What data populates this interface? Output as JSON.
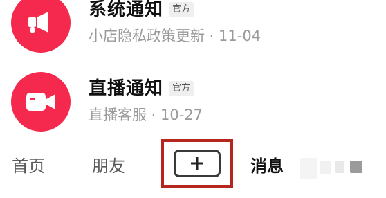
{
  "messages": [
    {
      "title": "系统通知",
      "badge": "官方",
      "subtitle": "小店隐私政策更新 · 11-04",
      "icon": "megaphone-icon",
      "avatar_color": "#f5294e"
    },
    {
      "title": "直播通知",
      "badge": "官方",
      "subtitle": "直播客服 · 10-27",
      "icon": "video-camera-icon",
      "avatar_color": "#f5294e"
    }
  ],
  "tabbar": {
    "home_label": "首页",
    "friends_label": "朋友",
    "add_icon": "plus-icon",
    "messages_label": "消息"
  },
  "colors": {
    "accent": "#f5294e",
    "highlight_border": "#b5261f"
  }
}
